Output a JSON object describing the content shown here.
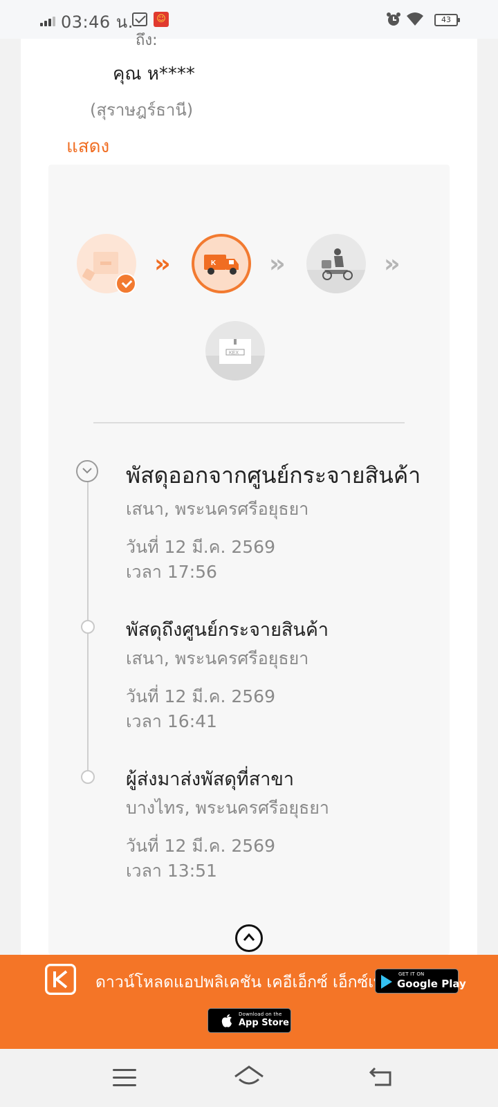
{
  "status_bar": {
    "time": "03:46 น.",
    "battery": "43"
  },
  "recipient": {
    "partial_label": "ถึง:",
    "name": "คุณ ห****",
    "province": "(สุราษฎร์ธานี)",
    "show_link": "แสดง"
  },
  "progress": {
    "steps": [
      "parcel-picked-up-icon",
      "delivery-truck-icon",
      "delivery-scooter-icon",
      "parcel-delivered-icon"
    ],
    "completed_steps": 1,
    "current_step": 2,
    "box_label": "KEX"
  },
  "timeline": [
    {
      "title": "พัสดุออกจากศูนย์กระจายสินค้า",
      "location": "เสนา, พระนครศรีอยุธยา",
      "date": "วันที่ 12 มี.ค. 2569",
      "time": "เวลา 17:56"
    },
    {
      "title": "พัสดุถึงศูนย์กระจายสินค้า",
      "location": "เสนา, พระนครศรีอยุธยา",
      "date": "วันที่ 12 มี.ค. 2569",
      "time": "เวลา 16:41"
    },
    {
      "title": "ผู้ส่งมาส่งพัสดุที่สาขา",
      "location": "บางไทร, พระนครศรีอยุธยา",
      "date": "วันที่ 12 มี.ค. 2569",
      "time": "เวลา 13:51"
    }
  ],
  "banner": {
    "text": "ดาวน์โหลดแอปพลิเคชัน เคอีเอ็กซ์ เอ็กซ์เพรส",
    "google_small": "GET IT ON",
    "google_big": "Google Play",
    "apple_small": "Download on the",
    "apple_big": "App Store"
  },
  "colors": {
    "accent": "#f47527",
    "text": "#222222",
    "muted": "#8a8a8a"
  }
}
